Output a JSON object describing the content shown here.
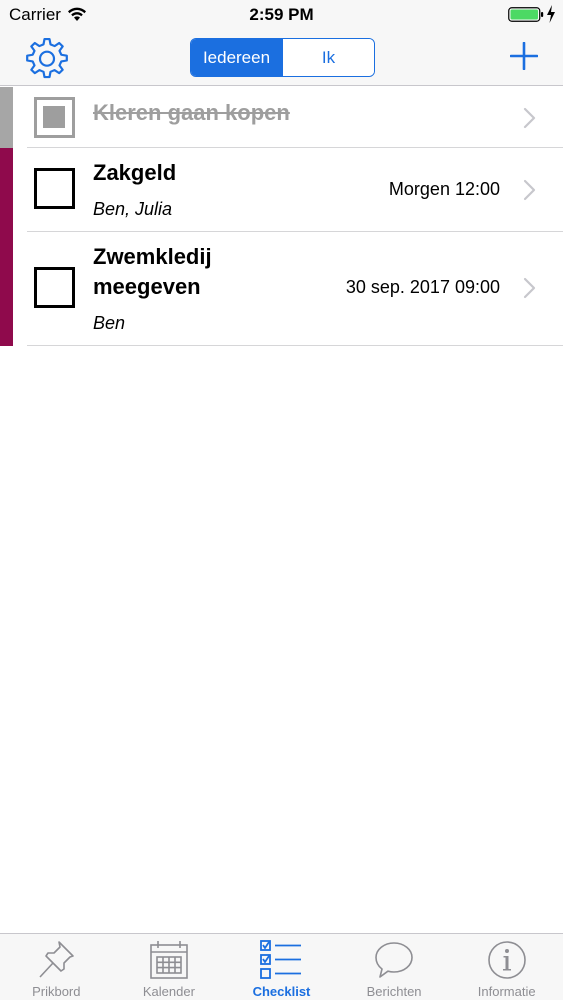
{
  "status_bar": {
    "carrier": "Carrier",
    "time": "2:59 PM",
    "battery_color": "#4cd964"
  },
  "nav": {
    "segments": [
      "Iedereen",
      "Ik"
    ],
    "selected_segment": "Iedereen",
    "accent_color": "#1b6fe0",
    "left_icon": "gear-icon",
    "right_icon": "plus-icon"
  },
  "items": [
    {
      "title": "Kleren gaan kopen",
      "done": true,
      "color": "#a6a6a6"
    },
    {
      "title": "Zakgeld",
      "assignees": "Ben, Julia",
      "due": "Morgen 12:00",
      "done": false,
      "color": "#8f0a4c"
    },
    {
      "title": "Zwemkledij meegeven",
      "assignees": "Ben",
      "due": "30 sep. 2017 09:00",
      "done": false,
      "color": "#8f0a4c"
    }
  ],
  "tabs": [
    {
      "label": "Prikbord",
      "icon": "pin-icon",
      "active": false
    },
    {
      "label": "Kalender",
      "icon": "calendar-icon",
      "active": false
    },
    {
      "label": "Checklist",
      "icon": "checklist-icon",
      "active": true
    },
    {
      "label": "Berichten",
      "icon": "chat-bubble-icon",
      "active": false
    },
    {
      "label": "Informatie",
      "icon": "info-icon",
      "active": false
    }
  ]
}
